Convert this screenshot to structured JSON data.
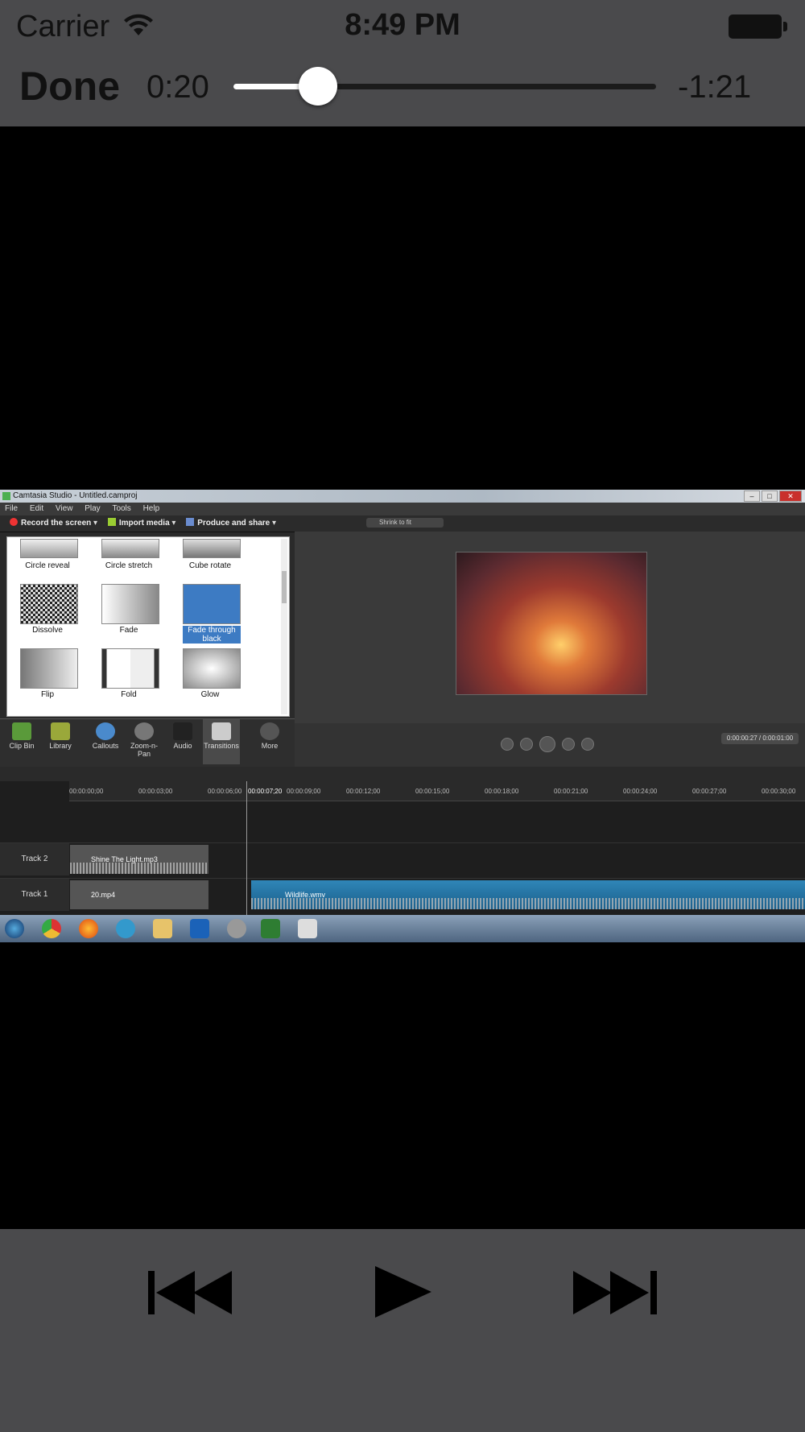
{
  "status_bar": {
    "carrier": "Carrier",
    "time": "8:49 PM"
  },
  "player": {
    "done_label": "Done",
    "time_elapsed": "0:20",
    "time_remaining": "-1:21",
    "progress_fraction": 0.2
  },
  "video_frame": {
    "window_title": "Camtasia Studio - Untitled.camproj",
    "menu": [
      "File",
      "Edit",
      "View",
      "Play",
      "Tools",
      "Help"
    ],
    "toolbar": {
      "record": "Record the screen",
      "import": "Import media",
      "produce": "Produce and share",
      "shrink": "Shrink to fit"
    },
    "transitions": [
      {
        "label": "Circle reveal"
      },
      {
        "label": "Circle stretch"
      },
      {
        "label": "Cube rotate"
      },
      {
        "label": "Dissolve"
      },
      {
        "label": "Fade"
      },
      {
        "label": "Fade through black"
      },
      {
        "label": "Flip"
      },
      {
        "label": "Fold"
      },
      {
        "label": "Glow"
      }
    ],
    "selected_transition": "Fade through black",
    "tabs": [
      {
        "label": "Clip Bin"
      },
      {
        "label": "Library"
      },
      {
        "label": "Callouts"
      },
      {
        "label": "Zoom-n-Pan"
      },
      {
        "label": "Audio"
      },
      {
        "label": "Transitions"
      },
      {
        "label": "More"
      }
    ],
    "preview_time": "0:00:00:27 / 0:00:01:00",
    "ruler": [
      "00:00:00;00",
      "00:00:03;00",
      "00:00:06;00",
      "00:00:07;20",
      "00:00:09;00",
      "00:00:12;00",
      "00:00:15;00",
      "00:00:18;00",
      "00:00:21;00",
      "00:00:24;00",
      "00:00:27;00",
      "00:00:30;00"
    ],
    "tracks": [
      {
        "name": "Track 2",
        "clip": "Shine The Light.mp3"
      },
      {
        "name": "Track 1",
        "clip": "20.mp4",
        "clip2": "Wildlife.wmv"
      }
    ]
  },
  "colors": {
    "chrome": "#4a4a4c",
    "selected": "#3d7bc3"
  },
  "controls": {
    "prev": "rewind-icon",
    "play": "play-icon",
    "next": "fast-forward-icon"
  }
}
